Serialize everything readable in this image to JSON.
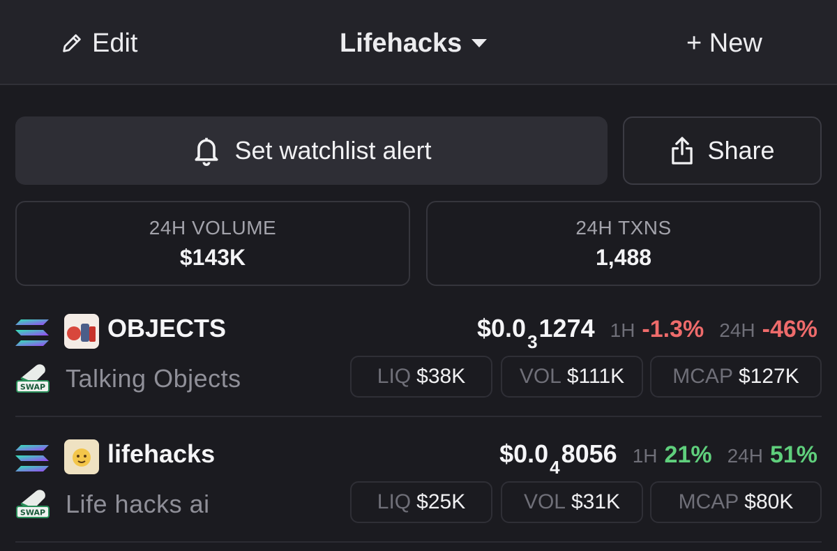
{
  "topbar": {
    "edit_label": "Edit",
    "title": "Lifehacks",
    "new_label": "+ New"
  },
  "actions": {
    "alert_label": "Set watchlist alert",
    "share_label": "Share"
  },
  "stats": {
    "volume": {
      "label": "24H VOLUME",
      "value": "$143K"
    },
    "txns": {
      "label": "24H TXNS",
      "value": "1,488"
    }
  },
  "tokens": [
    {
      "symbol": "OBJECTS",
      "name": "Talking Objects",
      "price_prefix": "$0.0",
      "price_zeros": "3",
      "price_digits": "1274",
      "h1_label": "1H",
      "h1": "-1.3%",
      "h1_direction": "negative",
      "h24_label": "24H",
      "h24": "-46%",
      "h24_direction": "negative",
      "liq_label": "LIQ",
      "liq": "$38K",
      "vol_label": "VOL",
      "vol": "$111K",
      "mcap_label": "MCAP",
      "mcap": "$127K",
      "chain_icon": "solana-icon",
      "dex_icon": "swap-icon"
    },
    {
      "symbol": "lifehacks",
      "name": "Life hacks ai",
      "price_prefix": "$0.0",
      "price_zeros": "4",
      "price_digits": "8056",
      "h1_label": "1H",
      "h1": "21%",
      "h1_direction": "positive",
      "h24_label": "24H",
      "h24": "51%",
      "h24_direction": "positive",
      "liq_label": "LIQ",
      "liq": "$25K",
      "vol_label": "VOL",
      "vol": "$31K",
      "mcap_label": "MCAP",
      "mcap": "$80K",
      "chain_icon": "solana-icon",
      "dex_icon": "swap-icon"
    }
  ],
  "dex_badge_text": "SWAP",
  "colors": {
    "negative": "#ee6b6b",
    "positive": "#5fcf7c",
    "background": "#1b1b20",
    "card": "#2e2e35"
  }
}
